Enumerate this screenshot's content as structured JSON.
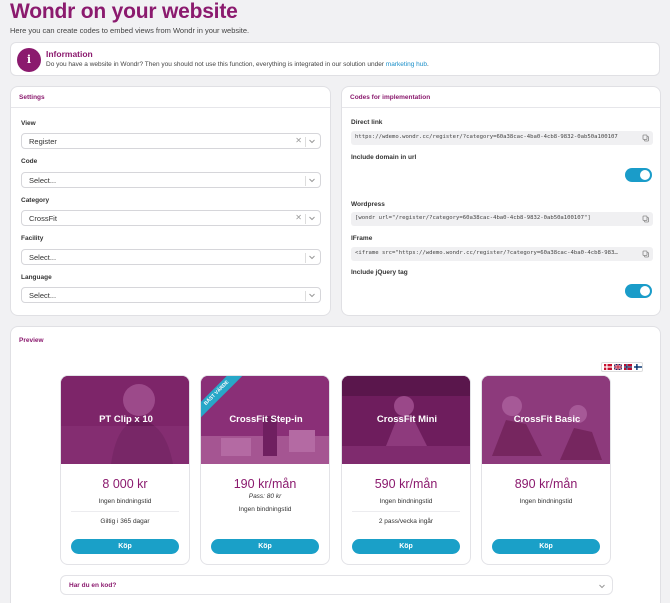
{
  "page": {
    "title": "Wondr on your website",
    "subtitle": "Here you can create codes to embed views from Wondr in your website."
  },
  "info": {
    "icon": "info-icon",
    "title": "Information",
    "text": "Do you have a website in Wondr? Then you should not use this function, everything is integrated in our solution under",
    "link": "marketing hub",
    "suffix": "."
  },
  "settings": {
    "title": "Settings",
    "fields": [
      {
        "label": "View",
        "value": "Register",
        "clearable": true
      },
      {
        "label": "Code",
        "value": "Select...",
        "clearable": false
      },
      {
        "label": "Category",
        "value": "CrossFit",
        "clearable": true
      },
      {
        "label": "Facility",
        "value": "Select...",
        "clearable": false
      },
      {
        "label": "Language",
        "value": "Select...",
        "clearable": false
      }
    ]
  },
  "codes": {
    "title": "Codes for implementation",
    "direct_link_label": "Direct link",
    "direct_link": "https://wdemo.wondr.cc/register/?category=60a38cac-4ba0-4cb8-9832-0ab50a100107",
    "include_domain_label": "Include domain in url",
    "include_domain": true,
    "wordpress_label": "Wordpress",
    "wordpress": "[wondr url=\"/register/?category=60a38cac-4ba0-4cb8-9832-0ab50a100107\"]",
    "iframe_label": "IFrame",
    "iframe": "<iframe src=\"https://wdemo.wondr.cc/register/?category=60a38cac-4ba0-4cb8-983…",
    "include_jquery_label": "Include jQuery tag",
    "include_jquery": true
  },
  "preview": {
    "title": "Preview",
    "languages": [
      "dk",
      "gb",
      "no",
      "fi"
    ],
    "products": [
      {
        "name": "PT Clip x 10",
        "price": "8 000 kr",
        "line1": "Ingen bindningstid",
        "line3": "Giltig i 365 dagar",
        "button": "Köp"
      },
      {
        "name": "CrossFit Step-in",
        "badge": "BÄST VÄRDE",
        "price": "190 kr/mån",
        "italic": "Pass: 80 kr",
        "line2": "Ingen bindningstid",
        "button": "Köp"
      },
      {
        "name": "CrossFit Mini",
        "price": "590 kr/mån",
        "line1": "Ingen bindningstid",
        "line3": "2 pass/vecka ingår",
        "button": "Köp"
      },
      {
        "name": "CrossFit Basic",
        "price": "890 kr/mån",
        "line1": "Ingen bindningstid",
        "button": "Köp"
      }
    ],
    "code_prompt": "Har du en kod?"
  },
  "colors": {
    "brand": "#8b1a6e",
    "accent": "#1aa0c8"
  }
}
